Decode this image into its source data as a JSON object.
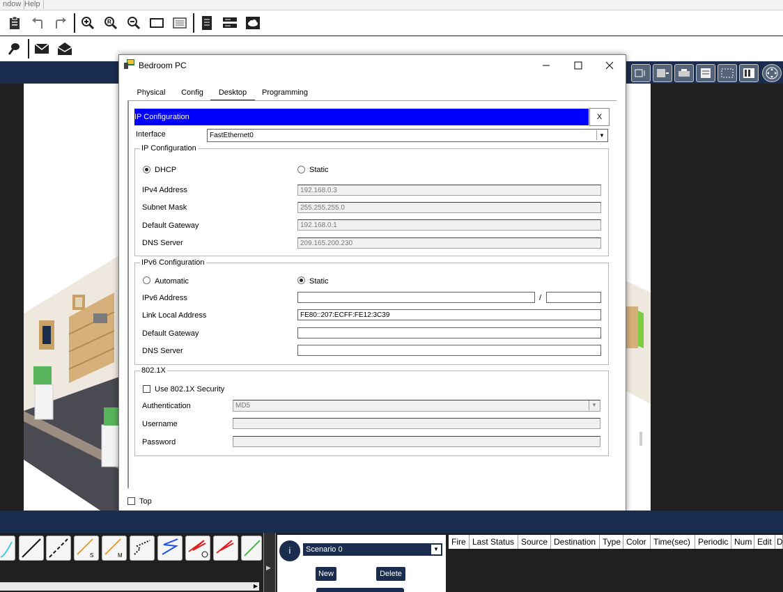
{
  "menu": {
    "window": "ndow",
    "help": "Help"
  },
  "toolbar1": {
    "icons": [
      "clipboard-icon",
      "undo-icon",
      "redo-icon",
      "zoom-in-icon",
      "zoom-reset-icon",
      "zoom-out-icon",
      "rectangle-icon",
      "palette-icon",
      "document-icon",
      "server-icon",
      "cloud-icon"
    ]
  },
  "toolbar2": {
    "icons": [
      "pin-icon",
      "message-icon",
      "open-message-icon"
    ]
  },
  "dialog": {
    "title": "Bedroom PC",
    "tabs": [
      "Physical",
      "Config",
      "Desktop",
      "Programming"
    ],
    "active_tab": "Desktop",
    "panel_title": "IP Configuration",
    "panel_close": "X",
    "interface_label": "Interface",
    "interface_value": "FastEthernet0",
    "ipv4": {
      "group_title": "IP Configuration",
      "dhcp_label": "DHCP",
      "static_label": "Static",
      "mode": "DHCP",
      "address_label": "IPv4 Address",
      "address": "192.168.0.3",
      "mask_label": "Subnet Mask",
      "mask": "255.255.255.0",
      "gateway_label": "Default Gateway",
      "gateway": "192.168.0.1",
      "dns_label": "DNS Server",
      "dns": "209.165.200.230"
    },
    "ipv6": {
      "group_title": "IPv6 Configuration",
      "auto_label": "Automatic",
      "static_label": "Static",
      "mode": "Static",
      "address_label": "IPv6 Address",
      "address": "",
      "slash": "/",
      "prefix": "",
      "linklocal_label": "Link Local Address",
      "linklocal": "FE80::207:ECFF:FE12:3C39",
      "gateway_label": "Default Gateway",
      "gateway": "",
      "dns_label": "DNS Server",
      "dns": ""
    },
    "dot1x": {
      "group_title": "802.1X",
      "use_label": "Use 802.1X Security",
      "use_checked": false,
      "auth_label": "Authentication",
      "auth_value": "MD5",
      "user_label": "Username",
      "user": "",
      "pass_label": "Password",
      "pass": ""
    },
    "top_label": "Top",
    "top_checked": false
  },
  "connections": {
    "labels": [
      "S",
      "M"
    ]
  },
  "scenario": {
    "name": "Scenario 0",
    "new_label": "New",
    "delete_label": "Delete",
    "info_icon": "i"
  },
  "pdu_table": {
    "columns": [
      "Fire",
      "Last Status",
      "Source",
      "Destination",
      "Type",
      "Color",
      "Time(sec)",
      "Periodic",
      "Num",
      "Edit",
      "D"
    ]
  },
  "colors": {
    "navy": "#1b2d4f",
    "title_blue": "#0000ff",
    "wall": "#efe8df",
    "floor": "#4a4a52"
  }
}
